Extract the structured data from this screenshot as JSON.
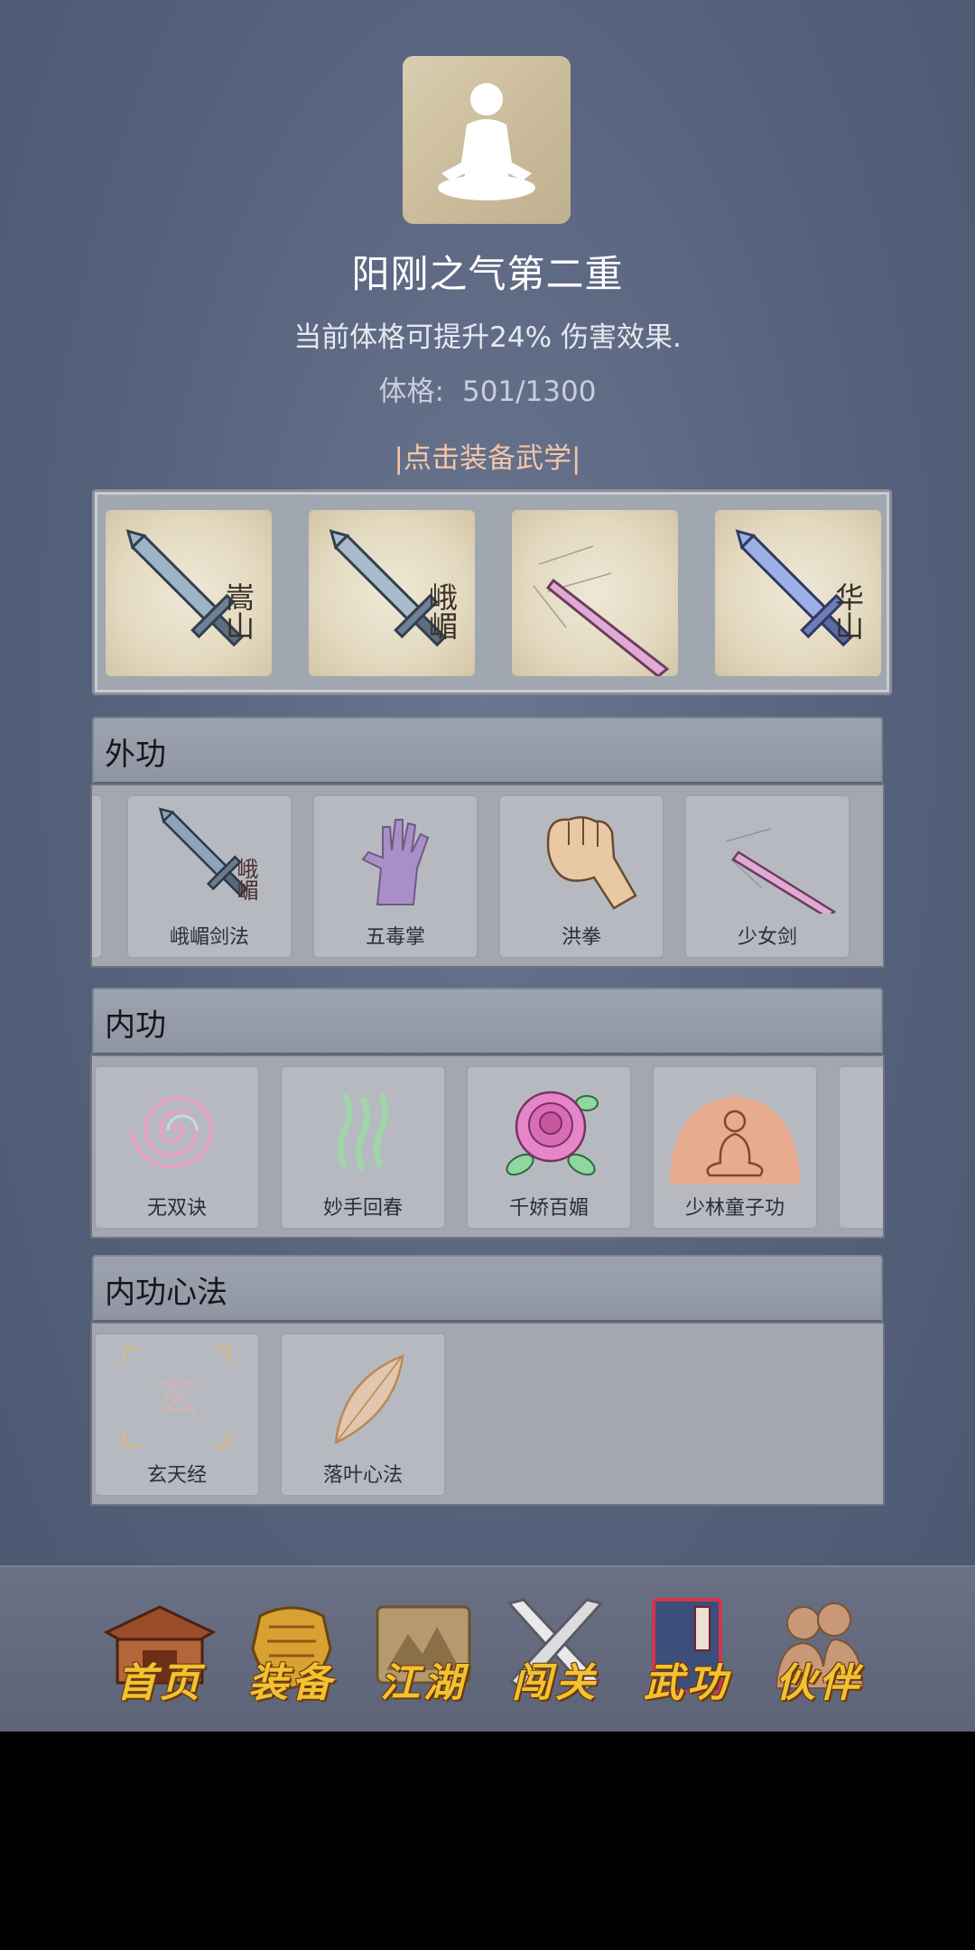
{
  "header": {
    "title": "阳刚之气第二重",
    "description": "当前体格可提升24% 伤害效果.",
    "stat_label": "体格:",
    "stat_value": "501/1300",
    "equip_hint": "|点击装备武学|"
  },
  "equipped": [
    {
      "icon": "sword-blue-icon",
      "char": "嵩山"
    },
    {
      "icon": "sword-blue-icon",
      "char": "峨嵋"
    },
    {
      "icon": "pink-sword-icon",
      "char": ""
    },
    {
      "icon": "sword-violet-icon",
      "char": "华山"
    }
  ],
  "sections": {
    "waigong": {
      "title": "外功",
      "items": [
        {
          "label": "峨嵋剑法",
          "icon": "sword-icon",
          "char": "峨嵋"
        },
        {
          "label": "五毒掌",
          "icon": "purple-palm-icon"
        },
        {
          "label": "洪拳",
          "icon": "fist-icon"
        },
        {
          "label": "少女剑",
          "icon": "pink-sword-icon"
        }
      ]
    },
    "neigong": {
      "title": "内功",
      "items": [
        {
          "label": "无双诀",
          "icon": "spiral-icon"
        },
        {
          "label": "妙手回春",
          "icon": "green-wave-icon"
        },
        {
          "label": "千娇百媚",
          "icon": "rose-icon"
        },
        {
          "label": "少林童子功",
          "icon": "meditation-icon"
        }
      ]
    },
    "xinfa": {
      "title": "内功心法",
      "items": [
        {
          "label": "玄天经",
          "icon": "xuan-glyph-icon",
          "glyph": "玄"
        },
        {
          "label": "落叶心法",
          "icon": "leaf-icon"
        }
      ]
    }
  },
  "nav": [
    {
      "label": "首页",
      "icon": "pavilion-icon"
    },
    {
      "label": "装备",
      "icon": "armor-icon"
    },
    {
      "label": "江湖",
      "icon": "scroll-map-icon"
    },
    {
      "label": "闯关",
      "icon": "crossed-swords-icon"
    },
    {
      "label": "武功",
      "icon": "book-icon",
      "active": true
    },
    {
      "label": "伙伴",
      "icon": "companions-icon"
    }
  ]
}
